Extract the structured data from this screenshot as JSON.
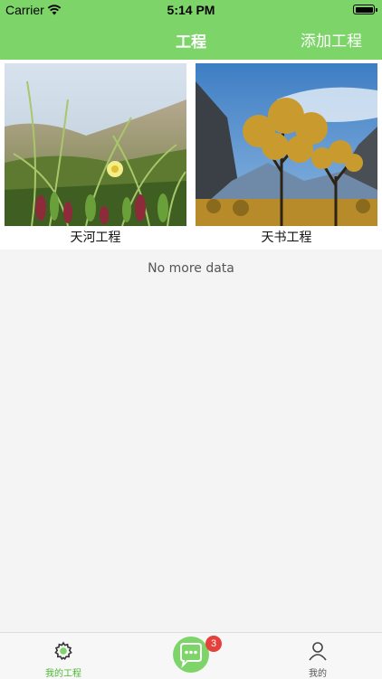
{
  "status_bar": {
    "carrier": "Carrier",
    "time": "5:14 PM"
  },
  "header": {
    "title": "工程",
    "add_label": "添加工程"
  },
  "projects": [
    {
      "name": "天河工程"
    },
    {
      "name": "天书工程"
    }
  ],
  "list_footer": "No more data",
  "tabbar": {
    "tabs": [
      {
        "label": "我的工程",
        "icon": "gear-icon",
        "active": true
      },
      {
        "label": "",
        "icon": "chat-bubble-icon",
        "badge": "3"
      },
      {
        "label": "我的",
        "icon": "person-icon"
      }
    ]
  },
  "colors": {
    "accent": "#7dd56a",
    "badge": "#e5403b",
    "background": "#f4f4f4"
  }
}
